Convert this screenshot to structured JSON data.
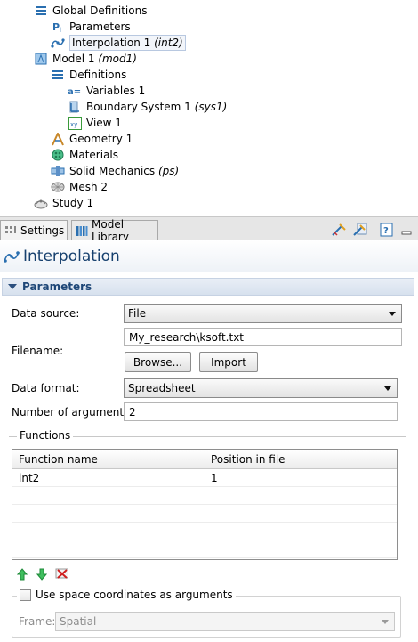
{
  "tree": {
    "items": [
      {
        "label": "Global Definitions",
        "tag": "",
        "icon": "global-definitions-icon"
      },
      {
        "label": "Parameters",
        "tag": "",
        "icon": "parameters-icon"
      },
      {
        "label": "Interpolation 1",
        "tag": "(int2)",
        "icon": "interpolation-icon"
      },
      {
        "label": "Model 1",
        "tag": "(mod1)",
        "icon": "model-icon"
      },
      {
        "label": "Definitions",
        "tag": "",
        "icon": "definitions-icon"
      },
      {
        "label": "Variables 1",
        "tag": "",
        "icon": "variables-icon"
      },
      {
        "label": "Boundary System 1",
        "tag": "(sys1)",
        "icon": "boundary-system-icon"
      },
      {
        "label": "View 1",
        "tag": "",
        "icon": "view-icon"
      },
      {
        "label": "Geometry 1",
        "tag": "",
        "icon": "geometry-icon"
      },
      {
        "label": "Materials",
        "tag": "",
        "icon": "materials-icon"
      },
      {
        "label": "Solid Mechanics",
        "tag": "(ps)",
        "icon": "solid-mechanics-icon"
      },
      {
        "label": "Mesh 2",
        "tag": "",
        "icon": "mesh-icon"
      },
      {
        "label": "Study 1",
        "tag": "",
        "icon": "study-icon"
      }
    ]
  },
  "tabs": {
    "settings": "Settings",
    "model_library": "Model Library"
  },
  "panel": {
    "title": "Interpolation",
    "section": "Parameters",
    "data_source_label": "Data source:",
    "data_source_value": "File",
    "filename_label": "Filename:",
    "filename_value": "My_research\\ksoft.txt",
    "browse_label": "Browse...",
    "import_label": "Import",
    "data_format_label": "Data format:",
    "data_format_value": "Spreadsheet",
    "num_args_label": "Number of arguments:",
    "num_args_value": "2",
    "functions_legend": "Functions",
    "table": {
      "headers": [
        "Function name",
        "Position in file"
      ],
      "rows": [
        [
          "int2",
          "1"
        ],
        [
          "",
          ""
        ],
        [
          "",
          ""
        ],
        [
          "",
          ""
        ],
        [
          "",
          ""
        ]
      ]
    },
    "space_coords_label": "Use space coordinates as arguments",
    "space_coords_checked": false,
    "frame_label": "Frame:",
    "frame_value": "Spatial"
  },
  "colors": {
    "title_text": "#16406e",
    "section_text": "#1d4677",
    "arrow_green": "#2aa84a",
    "delete_red": "#d02020"
  }
}
